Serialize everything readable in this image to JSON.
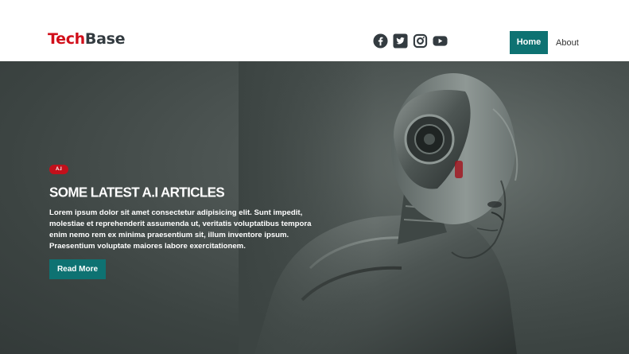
{
  "header": {
    "logo_part1": "Tech",
    "logo_part2": "Base",
    "social_icons": [
      "facebook-icon",
      "twitter-icon",
      "instagram-icon",
      "youtube-icon"
    ],
    "nav": {
      "home": "Home",
      "about": "About"
    }
  },
  "hero": {
    "badge": "A.I",
    "title": "Some Latest A.I Articles",
    "text": "Lorem ipsum dolor sit amet consectetur adipisicing elit. Sunt impedit, molestiae et reprehenderit assumenda ut, veritatis voluptatibus tempora enim nemo rem ex minima praesentium sit, illum inventore ipsum. Praesentium voluptate maiores labore exercitationem.",
    "button": "Read More"
  },
  "colors": {
    "brand_red": "#d10f1a",
    "accent_teal": "#0e7272",
    "dark_text": "#333b40"
  }
}
